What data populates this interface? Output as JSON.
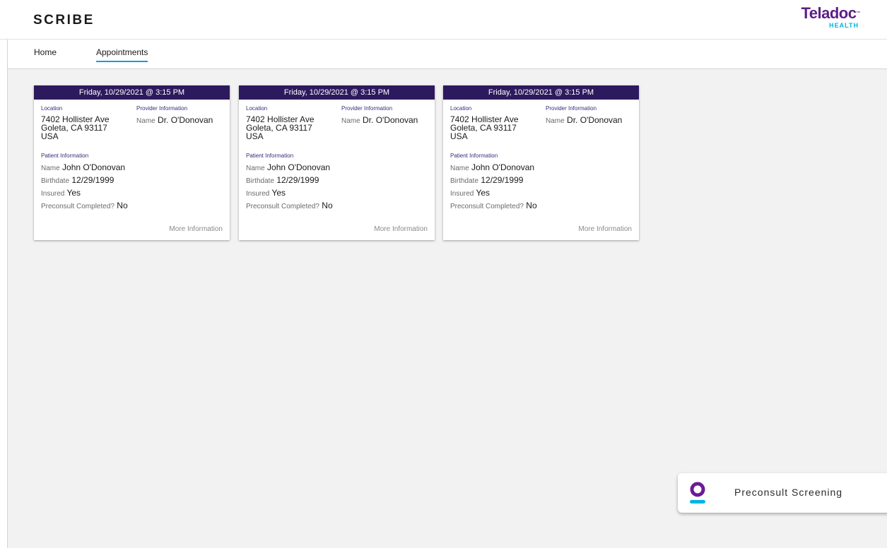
{
  "header": {
    "brand": "SCRIBE",
    "logo_main": "Teladoc",
    "logo_tm": "™",
    "logo_sub": "HEALTH"
  },
  "nav": {
    "items": [
      {
        "label": "Home",
        "active": false
      },
      {
        "label": "Appointments",
        "active": true
      }
    ]
  },
  "cards": [
    {
      "date": "Friday, 10/29/2021 @ 3:15 PM",
      "location_label": "Location",
      "address_line1": "7402 Hollister Ave",
      "address_line2": "Goleta, CA 93117",
      "address_line3": "USA",
      "provider_label": "Provider Information",
      "provider_name_label": "Name",
      "provider_name": "Dr. O'Donovan",
      "patient_label": "Patient Information",
      "patient_name_label": "Name",
      "patient_name": "John O'Donovan",
      "birthdate_label": "Birthdate",
      "birthdate": "12/29/1999",
      "insured_label": "Insured",
      "insured": "Yes",
      "preconsult_label": "Preconsult Completed?",
      "preconsult": "No",
      "more_label": "More Information"
    },
    {
      "date": "Friday, 10/29/2021 @ 3:15 PM",
      "location_label": "Location",
      "address_line1": "7402 Hollister Ave",
      "address_line2": "Goleta, CA 93117",
      "address_line3": "USA",
      "provider_label": "Provider Information",
      "provider_name_label": "Name",
      "provider_name": "Dr. O'Donovan",
      "patient_label": "Patient Information",
      "patient_name_label": "Name",
      "patient_name": "John O'Donovan",
      "birthdate_label": "Birthdate",
      "birthdate": "12/29/1999",
      "insured_label": "Insured",
      "insured": "Yes",
      "preconsult_label": "Preconsult Completed?",
      "preconsult": "No",
      "more_label": "More Information"
    },
    {
      "date": "Friday, 10/29/2021 @ 3:15 PM",
      "location_label": "Location",
      "address_line1": "7402 Hollister Ave",
      "address_line2": "Goleta, CA 93117",
      "address_line3": "USA",
      "provider_label": "Provider Information",
      "provider_name_label": "Name",
      "provider_name": "Dr. O'Donovan",
      "patient_label": "Patient Information",
      "patient_name_label": "Name",
      "patient_name": "John O'Donovan",
      "birthdate_label": "Birthdate",
      "birthdate": "12/29/1999",
      "insured_label": "Insured",
      "insured": "Yes",
      "preconsult_label": "Preconsult Completed?",
      "preconsult": "No",
      "more_label": "More Information"
    }
  ],
  "widget": {
    "label": "Preconsult Screening",
    "icon": "teladoc-person-icon"
  },
  "colors": {
    "card_header": "#2d1a5e",
    "brand_purple": "#5b1e86",
    "accent_blue": "#1b9bd7",
    "logo_cyan": "#00b5e2"
  }
}
